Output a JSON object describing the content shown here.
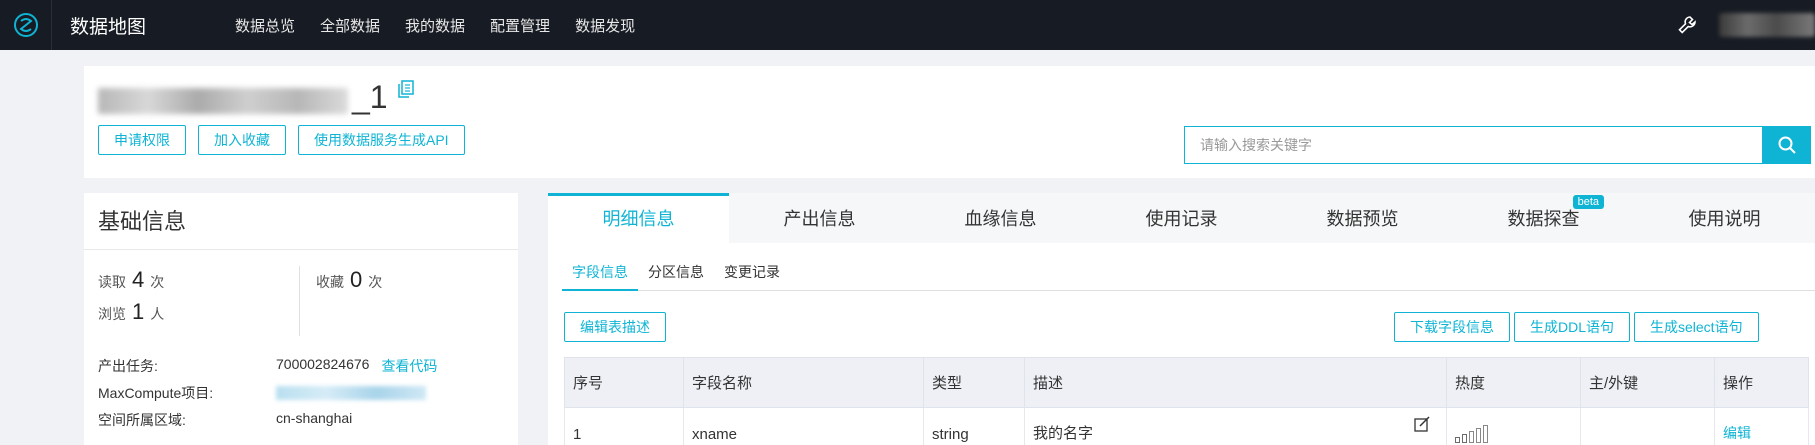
{
  "app": {
    "title": "数据地图"
  },
  "nav": [
    "数据总览",
    "全部数据",
    "我的数据",
    "配置管理",
    "数据发现"
  ],
  "header": {
    "name_suffix": "_1",
    "buttons": [
      "申请权限",
      "加入收藏",
      "使用数据服务生成API"
    ],
    "search_placeholder": "请输入搜索关键字"
  },
  "basic_info": {
    "title": "基础信息",
    "stats": [
      {
        "label": "读取",
        "value": "4",
        "unit": "次"
      },
      {
        "label": "收藏",
        "value": "0",
        "unit": "次"
      },
      {
        "label": "浏览",
        "value": "1",
        "unit": "人"
      }
    ],
    "rows": [
      {
        "label": "产出任务:",
        "value": "700002824676",
        "link": "查看代码"
      },
      {
        "label": "MaxCompute项目:",
        "value": ""
      },
      {
        "label": "空间所属区域:",
        "value": "cn-shanghai"
      }
    ]
  },
  "tabs": [
    "明细信息",
    "产出信息",
    "血缘信息",
    "使用记录",
    "数据预览",
    "数据探查",
    "使用说明"
  ],
  "tab_badge": "beta",
  "subtabs": [
    "字段信息",
    "分区信息",
    "变更记录"
  ],
  "actions": {
    "edit_desc": "编辑表描述",
    "download": "下载字段信息",
    "ddl": "生成DDL语句",
    "select": "生成select语句"
  },
  "table": {
    "columns": [
      "序号",
      "字段名称",
      "类型",
      "描述",
      "热度",
      "主/外键",
      "操作"
    ],
    "rows": [
      {
        "index": "1",
        "name": "xname",
        "type": "string",
        "desc": "我的名字",
        "heat": 2,
        "key": "",
        "action": "编辑"
      }
    ]
  },
  "colors": {
    "accent": "#0fb4d4",
    "topbar": "#171b23"
  }
}
